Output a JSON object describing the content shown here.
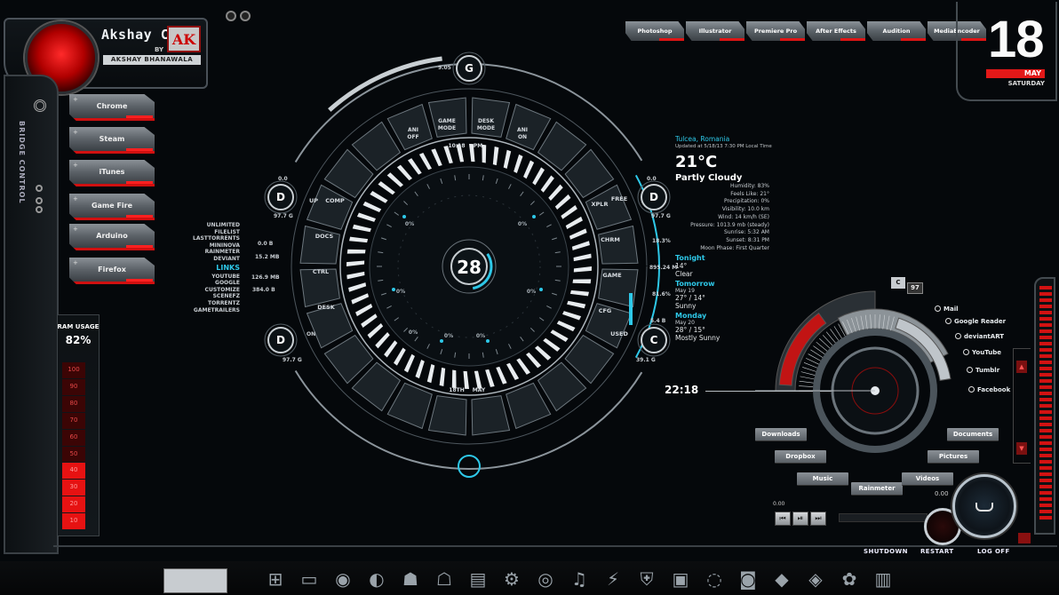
{
  "profile": {
    "name": "Akshay Cool",
    "by": "BY",
    "author": "AKSHAY BHANAWALA",
    "logo_text": "AK"
  },
  "sidebar": {
    "title": "BRIDGE CONTROL",
    "apps": [
      {
        "label": "Chrome"
      },
      {
        "label": "Steam"
      },
      {
        "label": "iTunes"
      },
      {
        "label": "Game Fire"
      },
      {
        "label": "Arduino"
      },
      {
        "label": "Firefox"
      }
    ]
  },
  "ram": {
    "label": "RAM USAGE",
    "value": "82%",
    "percent": 82,
    "scale": [
      "100",
      "90",
      "80",
      "70",
      "60",
      "50",
      "40",
      "30",
      "20",
      "10"
    ]
  },
  "links": {
    "items": [
      "UNLIMITED",
      "FILELIST",
      "LASTTORRENTS",
      "MININOVA",
      "RAINMETER",
      "DEVIANT"
    ],
    "header": "LINKS",
    "items2": [
      "YOUTUBE",
      "GOOGLE",
      "CUSTOMIZE",
      "SCENEFZ",
      "TORRENTZ",
      "GAMETRAILERS"
    ]
  },
  "hud": {
    "top_drive": "G",
    "left_top_drive": "D",
    "right_top_drive": "D",
    "left_bottom_drive": "D",
    "right_bottom_drive": "C",
    "center_value": "28",
    "buttons_top": [
      "ANI OFF",
      "GAME MODE",
      "DESK MODE",
      "ANI ON"
    ],
    "buttons_left": [
      "UP",
      "COMP",
      "DOCS",
      "CTRL",
      "DESK"
    ],
    "buttons_right": [
      "FREE",
      "XPLR",
      "CHRM",
      "GAME",
      "CFG",
      "USED"
    ],
    "time_small": "10:18",
    "pm": "PM",
    "date_bottom": "18TH",
    "month_bottom": "MAY",
    "left_on": "ON",
    "left_zero": "0.0",
    "stats_left": [
      "0.0 B",
      "15.2 MB",
      "126.9 MB",
      "384.0 B"
    ],
    "drive_left_top_label": "97.7 G",
    "drive_left_bottom_label": "97.7 G",
    "stats_right": [
      "18.3%",
      "895.24 M",
      "81.6%",
      "5.4 B"
    ],
    "drive_right_top_label": "97.7 G",
    "drive_right_bottom_label": "39.1 G",
    "drive_right_top_zero": "0.0",
    "drive_top_label": "9.05",
    "percent_labels": [
      "0%",
      "0%",
      "0%",
      "0%",
      "0%",
      "0%",
      "0%"
    ]
  },
  "menu": {
    "items": [
      "Photoshop",
      "Illustrator",
      "Premiere Pro",
      "After Effects",
      "Audition",
      "MediaEncoder"
    ]
  },
  "date": {
    "day": "18",
    "month": "MAY",
    "weekday": "SATURDAY"
  },
  "weather": {
    "location": "Tulcea, Romania",
    "updated": "Updated at 5/18/13 7:30 PM Local Time",
    "temp": "21°C",
    "condition": "Partly Cloudy",
    "details": [
      "Humidity: 83%",
      "Feels Like: 21°",
      "Precipitation: 0%",
      "Visibility: 10.0 km",
      "Wind: 14 km/h (SE)",
      "Pressure: 1013.9 mb (steady)",
      "Sunrise: 5:32 AM",
      "Sunset: 8:31 PM",
      "Moon Phase: First Quarter"
    ],
    "tonight": {
      "head": "Tonight",
      "temp": "14°",
      "cond": "Clear"
    },
    "tomorrow": {
      "head": "Tomorrow",
      "date": "May 19",
      "temp": "27° / 14°",
      "cond": "Sunny"
    },
    "monday": {
      "head": "Monday",
      "date": "May 20",
      "temp": "28° / 15°",
      "cond": "Mostly Sunny"
    }
  },
  "clock": {
    "time": "22:18"
  },
  "dial": {
    "drive_letter": "C",
    "drive_value": "97",
    "social": [
      "Mail",
      "Google Reader",
      "deviantART",
      "YouTube",
      "Tumblr",
      "Facebook"
    ],
    "folders": [
      "Downloads",
      "Documents",
      "Dropbox",
      "Pictures",
      "Music",
      "Rainmeter",
      "Videos"
    ]
  },
  "media": {
    "time_left": "0.00",
    "time_right": "0.00",
    "prev": "⏮",
    "play": "⏯",
    "next": "⏭"
  },
  "system": {
    "shutdown": "SHUTDOWN",
    "restart": "RESTART",
    "logoff": "LOG OFF"
  },
  "taskbar_icons": [
    "windows-icon",
    "monitor-icon",
    "chrome-icon",
    "firefox-icon",
    "android-icon",
    "android-alt-icon",
    "notes-icon",
    "gears-icon",
    "steam-icon",
    "itunes-icon",
    "lightning-icon",
    "shield-icon",
    "photoshop-icon",
    "ccleaner-icon",
    "camera-icon",
    "stealth-icon",
    "drop-icon",
    "palette-icon",
    "trash-icon"
  ],
  "colors": {
    "accent": "#2ec8e8",
    "danger": "#e01515",
    "chrome": "#8a9096"
  }
}
